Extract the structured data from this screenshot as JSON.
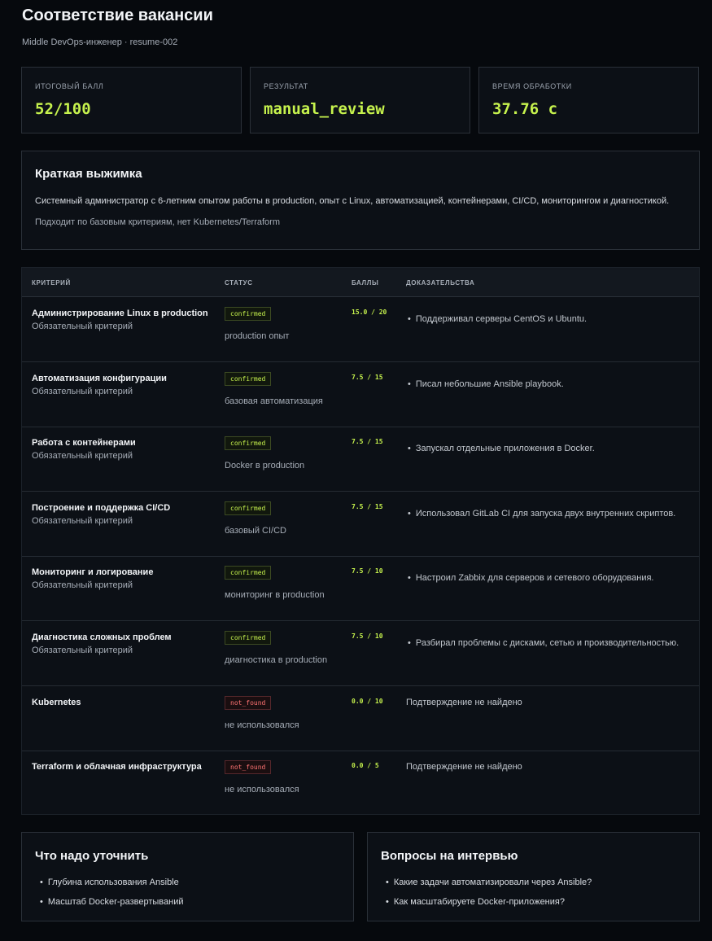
{
  "header": {
    "title": "Соответствие вакансии",
    "subtitle": "Middle DevOps-инженер · resume-002"
  },
  "stats": [
    {
      "label": "ИТОГОВЫЙ БАЛЛ",
      "value": "52/100"
    },
    {
      "label": "РЕЗУЛЬТАТ",
      "value": "manual_review"
    },
    {
      "label": "ВРЕМЯ ОБРАБОТКИ",
      "value": "37.76 с"
    }
  ],
  "summary": {
    "heading": "Краткая выжимка",
    "text": "Системный администратор с 6-летним опытом работы в production, опыт с Linux, автоматизацией, контейнерами, CI/CD, мониторингом и диагностикой.",
    "note": "Подходит по базовым критериям, нет Kubernetes/Terraform"
  },
  "table": {
    "headers": [
      "КРИТЕРИЙ",
      "СТАТУС",
      "БАЛЛЫ",
      "ДОКАЗАТЕЛЬСТВА"
    ],
    "rows": [
      {
        "criterion": "Администрирование Linux в production",
        "required": "Обязательный критерий",
        "status": "confirmed",
        "note": "production опыт",
        "score": "15.0 / 20",
        "evidence": "Поддерживал серверы CentOS и Ubuntu."
      },
      {
        "criterion": "Автоматизация конфигурации",
        "required": "Обязательный критерий",
        "status": "confirmed",
        "note": "базовая автоматизация",
        "score": "7.5 / 15",
        "evidence": "Писал небольшие Ansible playbook."
      },
      {
        "criterion": "Работа с контейнерами",
        "required": "Обязательный критерий",
        "status": "confirmed",
        "note": "Docker в production",
        "score": "7.5 / 15",
        "evidence": "Запускал отдельные приложения в Docker."
      },
      {
        "criterion": "Построение и поддержка CI/CD",
        "required": "Обязательный критерий",
        "status": "confirmed",
        "note": "базовый CI/CD",
        "score": "7.5 / 15",
        "evidence": "Использовал GitLab CI для запуска двух внутренних скриптов."
      },
      {
        "criterion": "Мониторинг и логирование",
        "required": "Обязательный критерий",
        "status": "confirmed",
        "note": "мониторинг в production",
        "score": "7.5 / 10",
        "evidence": "Настроил Zabbix для серверов и сетевого оборудования."
      },
      {
        "criterion": "Диагностика сложных проблем",
        "required": "Обязательный критерий",
        "status": "confirmed",
        "note": "диагностика в production",
        "score": "7.5 / 10",
        "evidence": "Разбирал проблемы с дисками, сетью и производительностью."
      },
      {
        "criterion": "Kubernetes",
        "required": "",
        "status": "not_found",
        "note": "не использовался",
        "score": "0.0 / 10",
        "evidence": "Подтверждение не найдено"
      },
      {
        "criterion": "Terraform и облачная инфраструктура",
        "required": "",
        "status": "not_found",
        "note": "не использовался",
        "score": "0.0 / 5",
        "evidence": "Подтверждение не найдено"
      }
    ]
  },
  "clarify": {
    "heading": "Что надо уточнить",
    "items": [
      "Глубина использования Ansible",
      "Масштаб Docker-развертываний"
    ]
  },
  "questions": {
    "heading": "Вопросы на интервью",
    "items": [
      "Какие задачи автоматизировали через Ansible?",
      "Как масштабируете Docker-приложения?"
    ]
  },
  "colors": {
    "accent": "#c6f24d",
    "danger": "#ff7373",
    "background": "#06090d",
    "panel": "#0c1016"
  }
}
